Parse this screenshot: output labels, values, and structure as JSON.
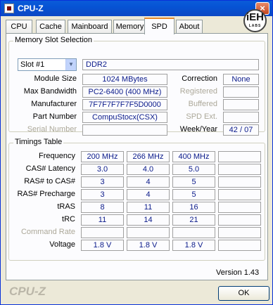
{
  "window": {
    "title": "CPU-Z",
    "close_glyph": "×"
  },
  "logo": {
    "text": "iEH",
    "sub": "LABS"
  },
  "tabs": [
    "CPU",
    "Cache",
    "Mainboard",
    "Memory",
    "SPD",
    "About"
  ],
  "active_tab": "SPD",
  "memory_slot": {
    "group_title": "Memory Slot Selection",
    "slot_value": "Slot #1",
    "memory_type": "DDR2",
    "labels": {
      "module_size": "Module Size",
      "max_bandwidth": "Max Bandwidth",
      "manufacturer": "Manufacturer",
      "part_number": "Part Number",
      "serial_number": "Serial Number",
      "correction": "Correction",
      "registered": "Registered",
      "buffered": "Buffered",
      "spd_ext": "SPD Ext.",
      "week_year": "Week/Year"
    },
    "values": {
      "module_size": "1024 MBytes",
      "max_bandwidth": "PC2-6400 (400 MHz)",
      "manufacturer": "7F7F7F7F7F5D0000",
      "part_number": "CompuStocx(CSX)",
      "serial_number": "",
      "correction": "None",
      "registered": "",
      "buffered": "",
      "spd_ext": "",
      "week_year": "42 / 07"
    }
  },
  "timings": {
    "group_title": "Timings Table",
    "rows": [
      {
        "label": "Frequency",
        "dim": false,
        "values": [
          "200 MHz",
          "266 MHz",
          "400 MHz",
          ""
        ]
      },
      {
        "label": "CAS# Latency",
        "dim": false,
        "values": [
          "3.0",
          "4.0",
          "5.0",
          ""
        ]
      },
      {
        "label": "RAS# to CAS#",
        "dim": false,
        "values": [
          "3",
          "4",
          "5",
          ""
        ]
      },
      {
        "label": "RAS# Precharge",
        "dim": false,
        "values": [
          "3",
          "4",
          "5",
          ""
        ]
      },
      {
        "label": "tRAS",
        "dim": false,
        "values": [
          "8",
          "11",
          "16",
          ""
        ]
      },
      {
        "label": "tRC",
        "dim": false,
        "values": [
          "11",
          "14",
          "21",
          ""
        ]
      },
      {
        "label": "Command Rate",
        "dim": true,
        "values": [
          "",
          "",
          "",
          ""
        ]
      },
      {
        "label": "Voltage",
        "dim": false,
        "values": [
          "1.8 V",
          "1.8 V",
          "1.8 V",
          ""
        ]
      }
    ]
  },
  "footer": {
    "version": "Version 1.43",
    "brand": "CPU-Z",
    "ok_label": "OK"
  }
}
